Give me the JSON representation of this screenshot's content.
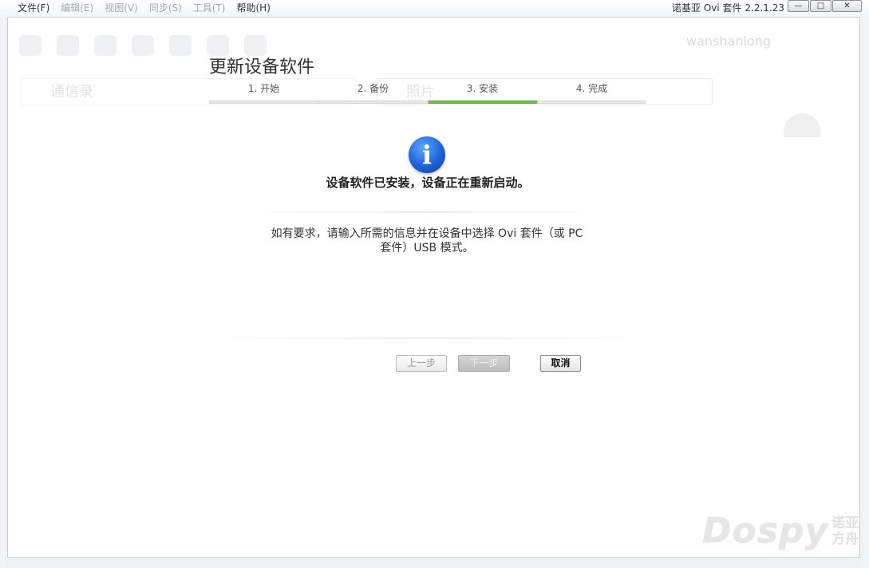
{
  "menubar": {
    "items": [
      {
        "label": "文件(F)",
        "enabled": true
      },
      {
        "label": "编辑(E)",
        "enabled": false
      },
      {
        "label": "视图(V)",
        "enabled": false
      },
      {
        "label": "同步(S)",
        "enabled": false
      },
      {
        "label": "工具(T)",
        "enabled": false
      },
      {
        "label": "帮助(H)",
        "enabled": true
      }
    ],
    "app_title": "诺基亚 Ovi 套件 2.2.1.23",
    "window_buttons": {
      "minimize": "—",
      "maximize": "□",
      "close": "✕"
    }
  },
  "background": {
    "user_name": "wanshanlong",
    "pane_a_label": "通信录",
    "pane_b_label": "照片"
  },
  "dialog": {
    "title": "更新设备软件",
    "steps": [
      {
        "label": "1. 开始",
        "active": false
      },
      {
        "label": "2. 备份",
        "active": false
      },
      {
        "label": "3. 安装",
        "active": true
      },
      {
        "label": "4. 完成",
        "active": false
      }
    ],
    "info_glyph": "i",
    "message_main": "设备软件已安装，设备正在重新启动。",
    "message_sub_line1": "如有要求，请输入所需的信息并在设备中选择 Ovi 套件（或 PC",
    "message_sub_line2": "套件）USB 模式。",
    "buttons": {
      "prev": "上一步",
      "next": "下一步",
      "cancel": "取消"
    }
  },
  "watermark": {
    "main": "Dospy",
    "side_line1": "诺亚",
    "side_line2": "方舟"
  },
  "colors": {
    "active_step": "#6cc14d",
    "info_icon": "#1e63d6"
  }
}
